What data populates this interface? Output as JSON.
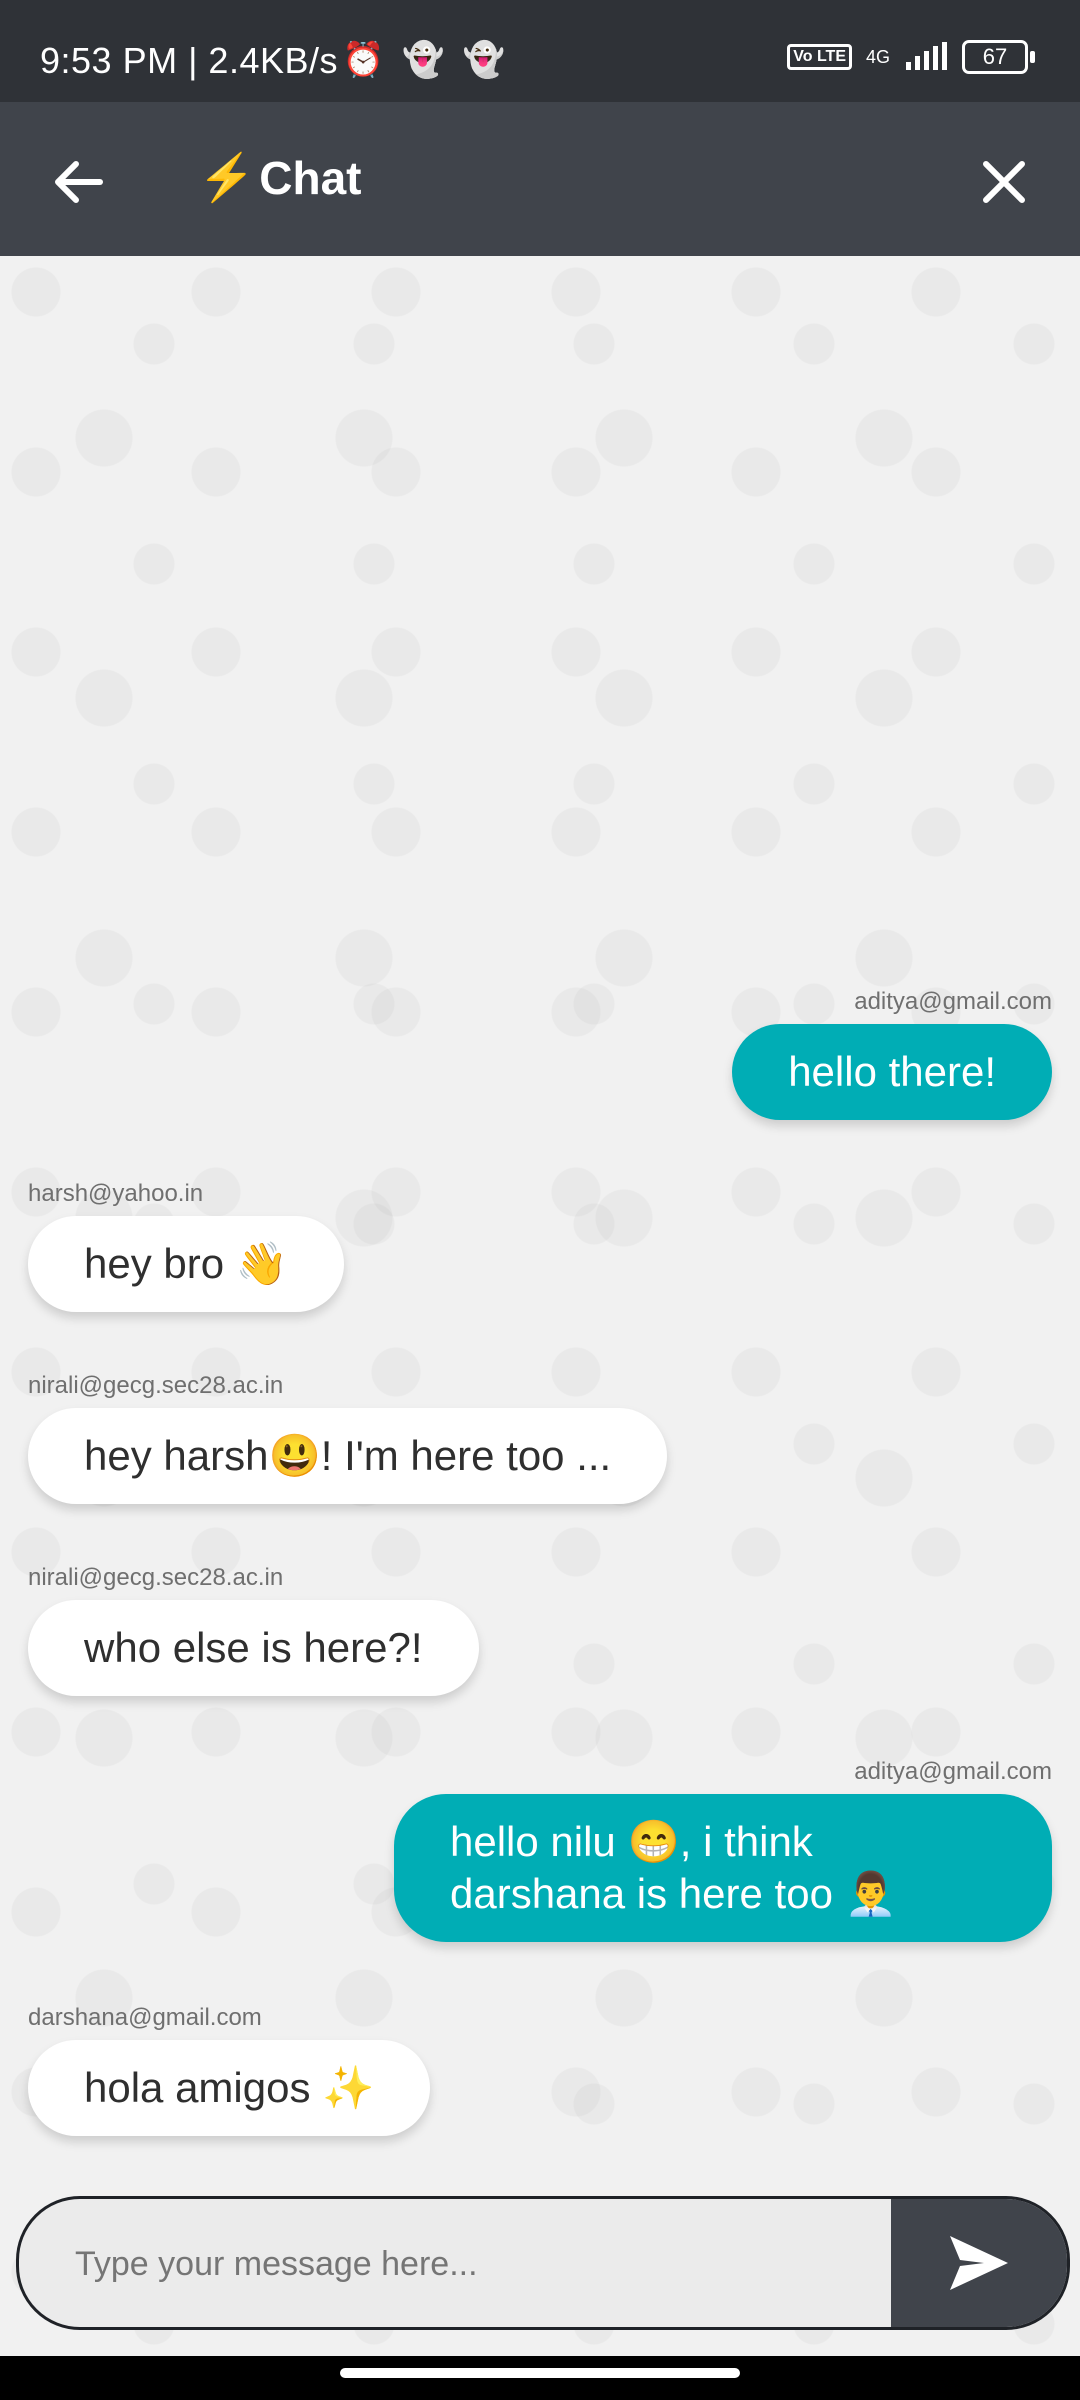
{
  "status": {
    "time": "9:53 PM | 2.4KB/s",
    "network": "4G",
    "volte": "Vo\nLTE",
    "battery": "67",
    "icons": [
      "alarm-icon",
      "snapchat-icon",
      "snapchat-icon",
      "signal-icon"
    ]
  },
  "header": {
    "title": "Chat",
    "title_icon": "⚡",
    "back_icon": "arrow-left-icon",
    "close_icon": "close-icon"
  },
  "messages": [
    {
      "sender": "aditya@gmail.com",
      "text": "hello there!",
      "side": "right"
    },
    {
      "sender": "harsh@yahoo.in",
      "text": "hey bro 👋",
      "side": "left"
    },
    {
      "sender": "nirali@gecg.sec28.ac.in",
      "text": "hey harsh😃! I'm here too ...",
      "side": "left"
    },
    {
      "sender": "nirali@gecg.sec28.ac.in",
      "text": "who else is here?!",
      "side": "left"
    },
    {
      "sender": "aditya@gmail.com",
      "text": "hello nilu 😁, i think darshana is here too 👨‍💼",
      "side": "right"
    },
    {
      "sender": "darshana@gmail.com",
      "text": "hola amigos ✨",
      "side": "left"
    }
  ],
  "composer": {
    "placeholder": "Type your message here...",
    "send_icon": "send-icon"
  },
  "colors": {
    "appbar": "#40444b",
    "outgoing_bubble": "#00adb5",
    "incoming_bubble": "#ffffff"
  }
}
